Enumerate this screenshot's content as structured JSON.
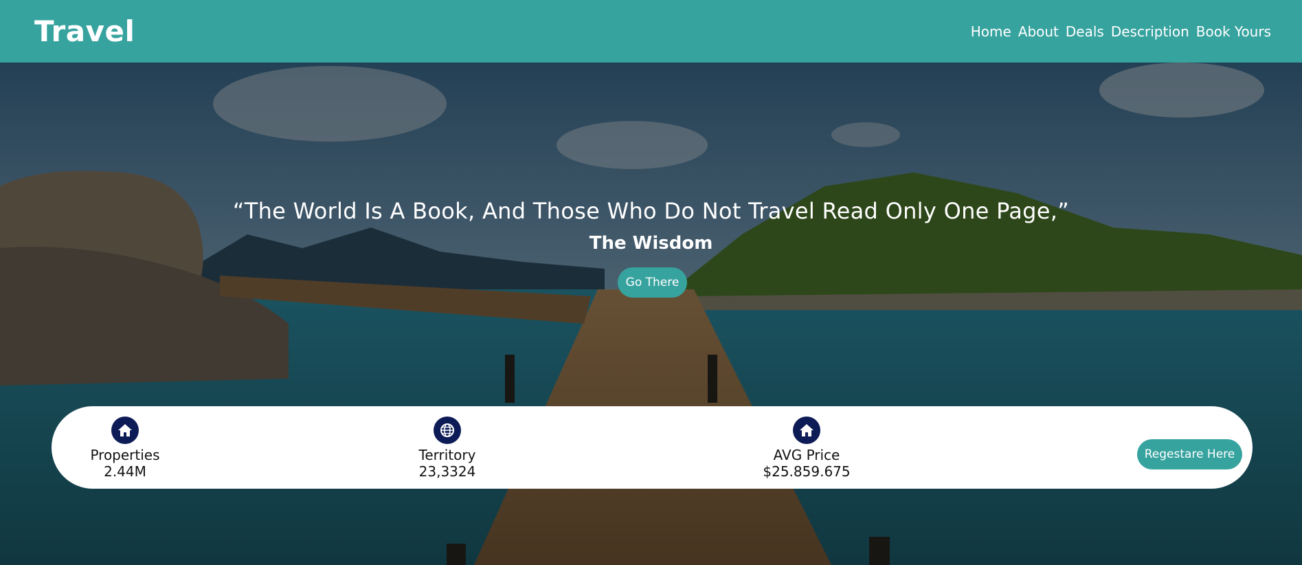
{
  "header": {
    "logo": "Travel",
    "nav": [
      "Home",
      "About",
      "Deals",
      "Description",
      "Book Yours"
    ]
  },
  "hero": {
    "quote": "“The World Is A Book, And Those Who Do Not Travel Read Only One Page,”",
    "author": "The Wisdom",
    "cta_label": "Go There"
  },
  "stats": {
    "items": [
      {
        "icon": "home-icon",
        "label": "Properties",
        "value": "2.44M"
      },
      {
        "icon": "globe-icon",
        "label": "Territory",
        "value": "23,3324"
      },
      {
        "icon": "home-icon",
        "label": "AVG Price",
        "value": "$25.859.675"
      }
    ],
    "register_label": "Regestare Here"
  },
  "colors": {
    "accent": "#37a39f",
    "icon_circle": "#0d1b56",
    "white": "#ffffff"
  }
}
